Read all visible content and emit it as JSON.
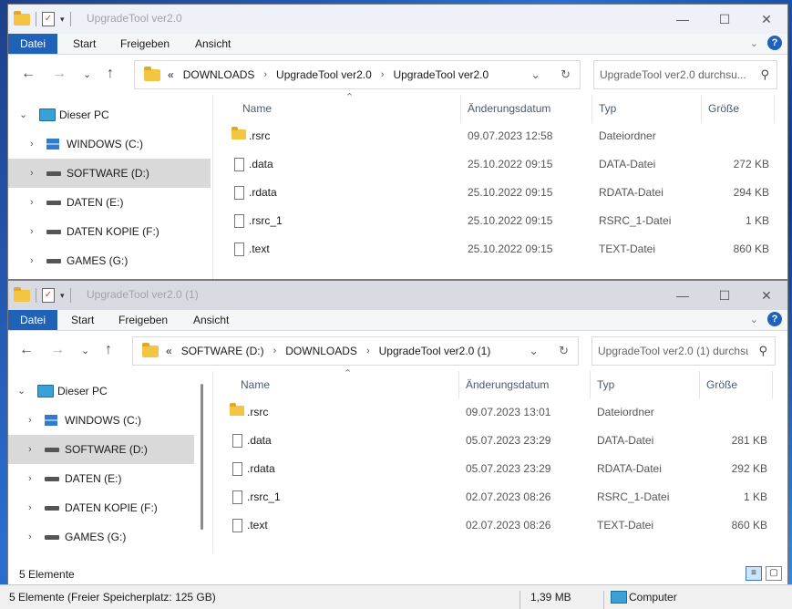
{
  "colors": {
    "accent": "#1f62b8",
    "selected": "#d9d9d9"
  },
  "ribbon_tabs": [
    "Datei",
    "Start",
    "Freigeben",
    "Ansicht"
  ],
  "columns": {
    "name": "Name",
    "date": "Änderungsdatum",
    "type": "Typ",
    "size": "Größe"
  },
  "tree": {
    "root": "Dieser PC",
    "drives": [
      "WINDOWS (C:)",
      "SOFTWARE (D:)",
      "DATEN (E:)",
      "DATEN KOPIE (F:)",
      "GAMES (G:)"
    ],
    "selected": "SOFTWARE (D:)"
  },
  "window1": {
    "title": "UpgradeTool ver2.0",
    "breadcrumb": [
      "«",
      "DOWNLOADS",
      "UpgradeTool ver2.0",
      "UpgradeTool ver2.0"
    ],
    "search_placeholder": "UpgradeTool ver2.0 durchsu...",
    "files": [
      {
        "icon": "folder-icon",
        "name": ".rsrc",
        "date": "09.07.2023 12:58",
        "type": "Dateiordner",
        "size": ""
      },
      {
        "icon": "file-icon",
        "name": ".data",
        "date": "25.10.2022 09:15",
        "type": "DATA-Datei",
        "size": "272 KB"
      },
      {
        "icon": "file-icon",
        "name": ".rdata",
        "date": "25.10.2022 09:15",
        "type": "RDATA-Datei",
        "size": "294 KB"
      },
      {
        "icon": "file-icon",
        "name": ".rsrc_1",
        "date": "25.10.2022 09:15",
        "type": "RSRC_1-Datei",
        "size": "1 KB"
      },
      {
        "icon": "file-icon",
        "name": ".text",
        "date": "25.10.2022 09:15",
        "type": "TEXT-Datei",
        "size": "860 KB"
      }
    ]
  },
  "window2": {
    "title": "UpgradeTool ver2.0 (1)",
    "breadcrumb": [
      "«",
      "SOFTWARE (D:)",
      "DOWNLOADS",
      "UpgradeTool ver2.0 (1)"
    ],
    "search_placeholder": "UpgradeTool ver2.0 (1) durchsu...",
    "files": [
      {
        "icon": "folder-icon",
        "name": ".rsrc",
        "date": "09.07.2023 13:01",
        "type": "Dateiordner",
        "size": ""
      },
      {
        "icon": "file-icon",
        "name": ".data",
        "date": "05.07.2023 23:29",
        "type": "DATA-Datei",
        "size": "281 KB"
      },
      {
        "icon": "file-icon",
        "name": ".rdata",
        "date": "05.07.2023 23:29",
        "type": "RDATA-Datei",
        "size": "292 KB"
      },
      {
        "icon": "file-icon",
        "name": ".rsrc_1",
        "date": "02.07.2023 08:26",
        "type": "RSRC_1-Datei",
        "size": "1 KB"
      },
      {
        "icon": "file-icon",
        "name": ".text",
        "date": "02.07.2023 08:26",
        "type": "TEXT-Datei",
        "size": "860 KB"
      }
    ],
    "status_count": "5 Elemente"
  },
  "bottom_bar": {
    "info": "5 Elemente (Freier Speicherplatz: 125 GB)",
    "size": "1,39 MB",
    "location": "Computer"
  }
}
